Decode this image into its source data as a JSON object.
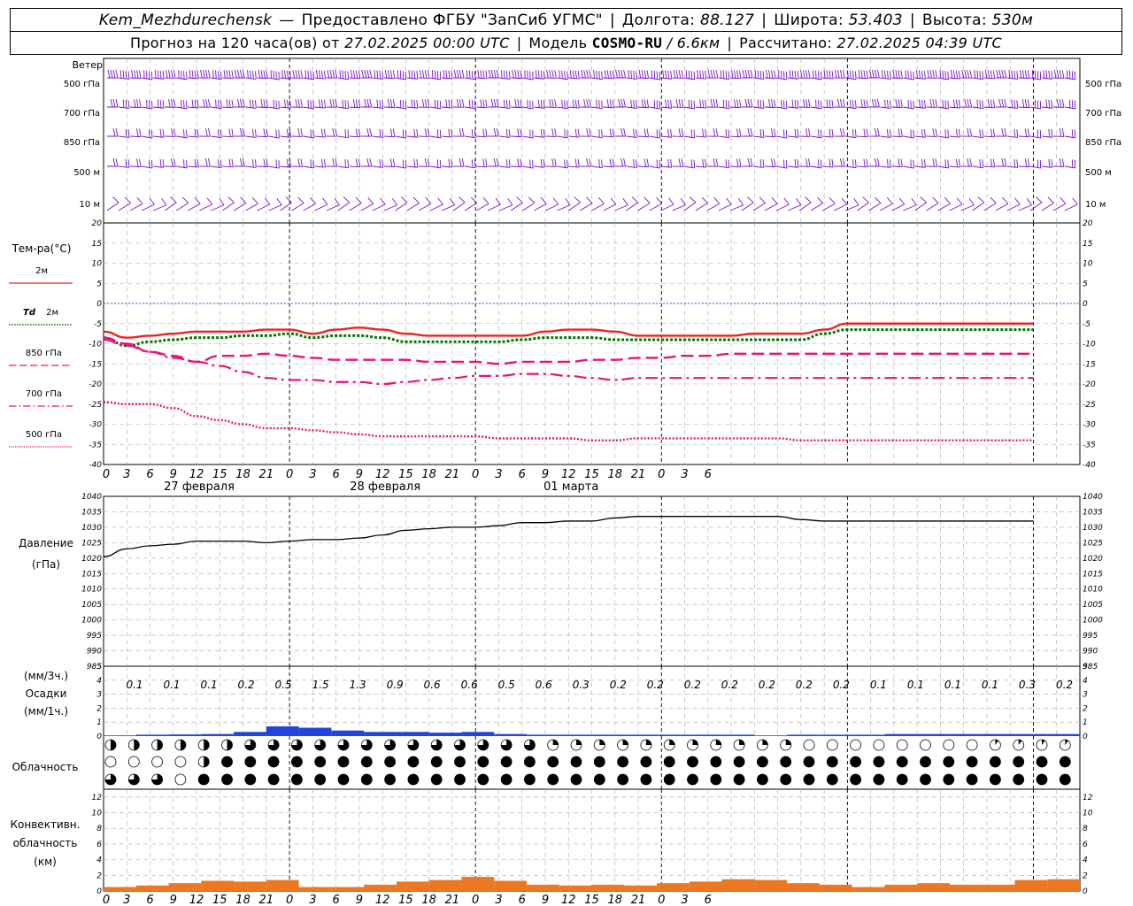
{
  "header": {
    "station": "Kem_Mezhdurechensk",
    "provider": "Предоставлено ФГБУ \"ЗапСиб УГМС\"",
    "lon_label": "Долгота:",
    "lon": "88.127",
    "lat_label": "Широта:",
    "lat": "53.403",
    "alt_label": "Высота:",
    "alt": "530м",
    "forecast_label": "Прогноз на 120 часа(ов)  от",
    "forecast_start": "27.02.2025 00:00 UTC",
    "model_label": "Модель",
    "model": "COSMO-RU",
    "resolution": "/ 6.6км",
    "computed_label": "Рассчитано:",
    "computed": "27.02.2025 04:39 UTC"
  },
  "labels": {
    "wind": "Ветер",
    "wind_levels": [
      "500 гПа",
      "700 гПа",
      "850 гПа",
      "500 м",
      "10  м"
    ],
    "temp": "Тем-ра(°С)",
    "legend_2m": "2м",
    "legend_td": "Td",
    "legend_td2": "2м",
    "legend_850": "850 гПа",
    "legend_700": "700 гПа",
    "legend_500": "500 гПа",
    "pressure": "Давление",
    "pressure_unit": "(гПа)",
    "precip_unit3": "(мм/3ч.)",
    "precip": "Осадки",
    "precip_unit1": "(мм/1ч.)",
    "cloud": "Облачность",
    "conv1": "Конвективн.",
    "conv2": "облачность",
    "conv3": "(км)"
  },
  "colors": {
    "t2m": "#ee2222",
    "td2m": "#007700",
    "t850": "#e8127a",
    "t700": "#e8127a",
    "t500": "#e8127a",
    "wind": "#7711cc",
    "precip": "#2244dd",
    "conv": "#ee7722",
    "zero": "#3355ff"
  },
  "chart_data": [
    {
      "type": "line",
      "title": "Тем-ра(°С)",
      "x_hours": [
        0,
        3,
        6,
        9,
        12,
        15,
        18,
        21,
        24,
        27,
        30,
        33,
        36,
        39,
        42,
        45,
        48,
        51,
        54,
        57,
        60,
        63,
        66,
        69,
        72,
        75,
        78,
        81,
        84,
        87,
        90,
        93,
        96,
        99,
        102,
        105,
        108,
        111,
        114,
        117,
        120
      ],
      "ylim": [
        -40,
        20
      ],
      "series": [
        {
          "name": "2м",
          "values": [
            -7,
            -8.5,
            -8,
            -7.5,
            -7,
            -7,
            -7,
            -6.5,
            -6.5,
            -7.5,
            -6.5,
            -6,
            -6.5,
            -7.5,
            -8,
            -8,
            -8,
            -8,
            -8,
            -7,
            -6.5,
            -6.5,
            -7,
            -8,
            -8,
            -8,
            -8,
            -8,
            -7.5,
            -7.5,
            -7.5,
            -6.5,
            -5,
            -5,
            -5,
            -5,
            -5,
            -5,
            -5,
            -5,
            -5
          ]
        },
        {
          "name": "Td 2м",
          "values": [
            -8.5,
            -10.5,
            -9.5,
            -9,
            -8.5,
            -8.5,
            -8,
            -8,
            -7.5,
            -8.5,
            -8,
            -8,
            -8.5,
            -9.5,
            -9.5,
            -9.5,
            -9.5,
            -9.5,
            -9,
            -8.5,
            -8.5,
            -8.5,
            -9,
            -9,
            -9,
            -9,
            -9,
            -9,
            -9,
            -9,
            -9,
            -7.5,
            -6.5,
            -6.5,
            -6.5,
            -6.5,
            -6.5,
            -6.5,
            -6.5,
            -6.5,
            -6.5
          ]
        },
        {
          "name": "850 гПа",
          "values": [
            -8.5,
            -10,
            -12,
            -13,
            -14.5,
            -13,
            -13,
            -12.5,
            -13,
            -13.5,
            -14,
            -14,
            -14,
            -14,
            -14.5,
            -14.5,
            -14.5,
            -15,
            -14.5,
            -14.5,
            -14.5,
            -14,
            -14,
            -13.5,
            -13.5,
            -13,
            -13,
            -12.5,
            -12.5,
            -12.5,
            -12.5,
            -12.5,
            -12.5,
            -12.5,
            -12.5,
            -12.5,
            -12.5,
            -12.5,
            -12.5,
            -12.5,
            -12.5
          ]
        },
        {
          "name": "700 гПа",
          "values": [
            -9,
            -10.5,
            -12,
            -13.5,
            -14.5,
            -15.5,
            -17,
            -18.5,
            -19,
            -19,
            -19.5,
            -19.5,
            -20,
            -19.5,
            -19,
            -18.5,
            -18,
            -18,
            -17.5,
            -17.5,
            -18,
            -18.5,
            -19,
            -18.5,
            -18.5,
            -18.5,
            -18.5,
            -18.5,
            -18.5,
            -18.5,
            -18.5,
            -18.5,
            -18.5,
            -18.5,
            -18.5,
            -18.5,
            -18.5,
            -18.5,
            -18.5,
            -18.5,
            -18.5
          ]
        },
        {
          "name": "500 гПа",
          "values": [
            -24.5,
            -25,
            -25,
            -26,
            -28,
            -29,
            -30,
            -31,
            -31,
            -31.5,
            -32,
            -32.5,
            -33,
            -33,
            -33,
            -33,
            -33,
            -33.5,
            -33.5,
            -33.5,
            -33.5,
            -34,
            -34,
            -33.5,
            -33.5,
            -33.5,
            -33.5,
            -33.5,
            -33.5,
            -33.5,
            -34,
            -34,
            -34,
            -34,
            -34,
            -34,
            -34,
            -34,
            -34,
            -34,
            -34
          ]
        }
      ]
    },
    {
      "type": "line",
      "title": "Давление",
      "ylabel": "(гПа)",
      "ylim": [
        985,
        1040
      ],
      "x_hours": [
        0,
        3,
        6,
        9,
        12,
        15,
        18,
        21,
        24,
        27,
        30,
        33,
        36,
        39,
        42,
        45,
        48,
        51,
        54,
        57,
        60,
        63,
        66,
        69,
        72,
        75,
        78,
        81,
        84,
        87,
        90,
        93,
        96,
        99,
        102,
        105,
        108,
        111,
        114,
        117,
        120
      ],
      "series": [
        {
          "name": "Давление",
          "values": [
            1020.5,
            1023,
            1024,
            1024.5,
            1025.5,
            1025.5,
            1025.5,
            1025,
            1025.5,
            1026,
            1026,
            1026.5,
            1027.5,
            1029,
            1029.5,
            1030,
            1030,
            1030.5,
            1031.5,
            1031.5,
            1032,
            1032,
            1033,
            1033.5,
            1033.5,
            1033.5,
            1033.5,
            1033.5,
            1033.5,
            1033.5,
            1032.5,
            1032,
            1032,
            1032,
            1032,
            1032,
            1032,
            1032,
            1032,
            1032,
            1032
          ]
        }
      ]
    },
    {
      "type": "bar",
      "title": "Осадки",
      "ylim": [
        0,
        5
      ],
      "categories_hours": [
        0,
        3,
        6,
        9,
        12,
        15,
        18,
        21,
        24,
        27,
        30,
        33,
        36,
        39,
        42,
        45,
        48,
        51,
        54,
        57,
        60,
        63,
        66,
        69,
        72,
        75
      ],
      "labels_3h": [
        "0.1",
        "0.1",
        "0.1",
        "0.2",
        "0.5",
        "1.5",
        "1.3",
        "0.9",
        "0.6",
        "0.6",
        "0.5",
        "0.6",
        "0.3",
        "0.2",
        "0.2",
        "0.2",
        "0.2",
        "0.2",
        "0.2",
        "0.2",
        "0.1",
        "0.1",
        "0.1",
        "0.1",
        "0.3",
        "0.2"
      ],
      "values_1h": [
        0.05,
        0.1,
        0.12,
        0.15,
        0.3,
        0.7,
        0.6,
        0.4,
        0.3,
        0.3,
        0.25,
        0.3,
        0.15,
        0.1,
        0.1,
        0.1,
        0.1,
        0.1,
        0.1,
        0.1,
        0.05,
        0.1,
        0.1,
        0.1,
        0.15,
        0.15,
        0.15,
        0.15,
        0.15,
        0.15
      ]
    },
    {
      "type": "bar",
      "title": "Конвективн. облачность",
      "ylabel": "(км)",
      "ylim": [
        0,
        13
      ],
      "values": [
        0.5,
        0.7,
        1,
        1.3,
        1.2,
        1.4,
        0.5,
        0.5,
        0.8,
        1.2,
        1.4,
        1.8,
        1.3,
        0.8,
        0.7,
        0.8,
        0.7,
        1,
        1.2,
        1.5,
        1.4,
        1,
        0.8,
        0.5,
        0.8,
        1,
        0.8,
        0.8,
        1.4,
        1.5
      ]
    }
  ],
  "time_axis": {
    "hour_labels": [
      "0",
      "3",
      "6",
      "9",
      "12",
      "15",
      "18",
      "21",
      "0",
      "3",
      "6",
      "9",
      "12",
      "15",
      "18",
      "21",
      "0",
      "3",
      "6",
      "9",
      "12",
      "15",
      "18",
      "21",
      "0",
      "3",
      "6"
    ],
    "dates": [
      "27 февраля",
      "28 февраля",
      "01 марта"
    ]
  }
}
